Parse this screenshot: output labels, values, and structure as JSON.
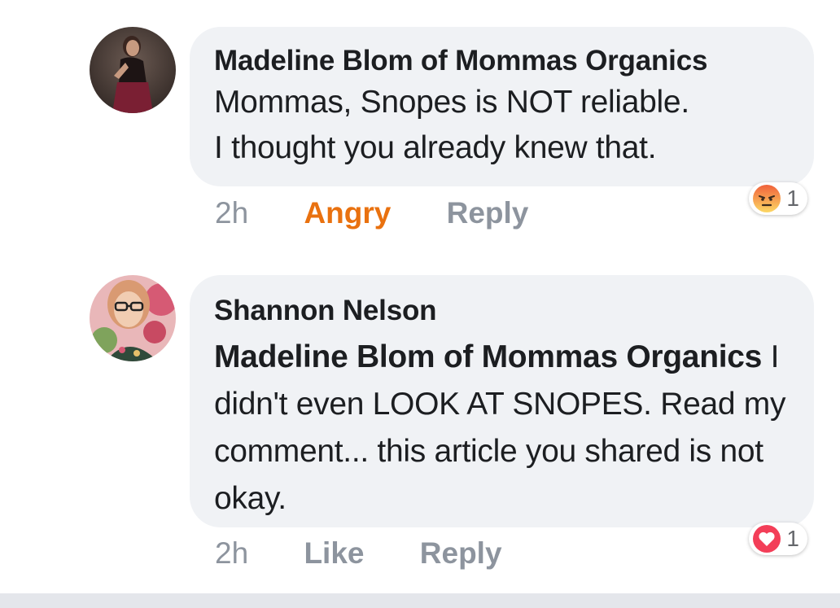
{
  "comments": [
    {
      "author": "Madeline Blom of Mommas Organics",
      "mention": "",
      "text_lines": [
        "Mommas, Snopes is NOT reliable.",
        "I thought you already knew that."
      ],
      "time": "2h",
      "action": "Angry",
      "reply": "Reply",
      "reaction_icon": "angry-face-icon",
      "reaction_count": "1",
      "avatar_icon": "avatar-photo"
    },
    {
      "author": "Shannon Nelson",
      "mention": "Madeline Blom of Mommas Organics",
      "text": "I didn't even LOOK AT SNOPES. Read my comment... this article you shared is not okay.",
      "time": "2h",
      "action": "Like",
      "reply": "Reply",
      "reaction_icon": "heart-icon",
      "reaction_count": "1",
      "avatar_icon": "avatar-photo"
    }
  ],
  "colors": {
    "bubble": "#f0f2f5",
    "angry": "#e9710f",
    "meta": "#8d949e",
    "love": "#f33e58"
  }
}
